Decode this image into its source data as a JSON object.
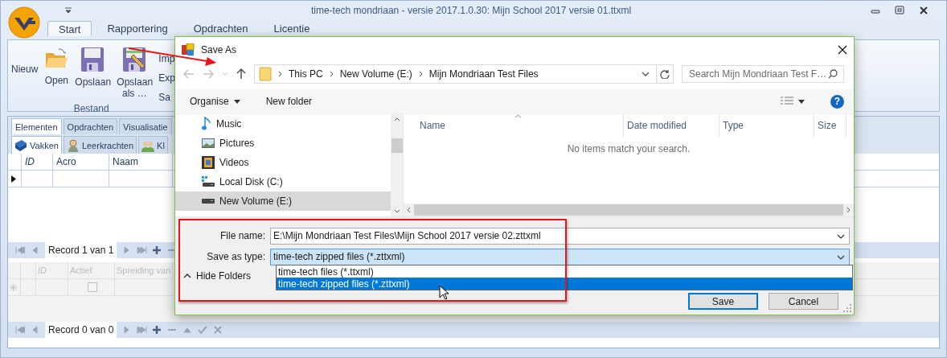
{
  "window": {
    "title": "time-tech mondriaan - versie 2017.1.0.30: Mijn School 2017 versie 01.ttxml"
  },
  "ribbon": {
    "tabs": [
      {
        "label": "Start",
        "selected": true
      },
      {
        "label": "Rapportering",
        "selected": false
      },
      {
        "label": "Opdrachten",
        "selected": false
      },
      {
        "label": "Licentie",
        "selected": false
      }
    ],
    "items": [
      {
        "label": "Nieuw",
        "kind": "text"
      },
      {
        "label": "Open",
        "kind": "open"
      },
      {
        "label": "Opslaan",
        "kind": "save"
      },
      {
        "label": "Opslaan als …",
        "kind": "saveas"
      }
    ],
    "small_items": [
      "Imp",
      "Exp",
      "Sa"
    ],
    "group": "Bestand"
  },
  "panel_tabs": [
    {
      "label": "Elementen",
      "selected": true
    },
    {
      "label": "Opdrachten",
      "selected": false
    },
    {
      "label": "Visualisatie",
      "selected": false
    }
  ],
  "sub_tabs": [
    {
      "label": "Vakken",
      "selected": true,
      "kind": "book"
    },
    {
      "label": "Leerkrachten",
      "selected": false,
      "kind": "person"
    },
    {
      "label": "Kl",
      "selected": false,
      "kind": "group"
    }
  ],
  "grid_top": {
    "columns": [
      "ID",
      "Acro",
      "Naam"
    ],
    "navigator": "Record 1 van 1"
  },
  "grid_bottom": {
    "columns": [
      "ID",
      "Actief",
      "Spreiding van"
    ],
    "checked": false,
    "navigator": "Record 0 van 0"
  },
  "dialog": {
    "title": "Save As",
    "breadcrumb": [
      "This PC",
      "New Volume (E:)",
      "Mijn Mondriaan Test Files"
    ],
    "search": {
      "placeholder": "Search Mijn Mondriaan Test F…"
    },
    "toolbar": [
      "Organise",
      "New folder"
    ],
    "help": "?",
    "folders": [
      {
        "label": "Music",
        "kind": "music",
        "selected": false
      },
      {
        "label": "Pictures",
        "kind": "pictures",
        "selected": false
      },
      {
        "label": "Videos",
        "kind": "videos",
        "selected": false
      },
      {
        "label": "Local Disk (C:)",
        "kind": "system-drive",
        "selected": false
      },
      {
        "label": "New Volume (E:)",
        "kind": "drive",
        "selected": true
      }
    ],
    "columns": [
      "Name",
      "Date modified",
      "Type",
      "Size"
    ],
    "empty_message": "No items match your search.",
    "file_name": {
      "label": "File name:",
      "value": "E:\\Mijn Mondriaan Test Files\\Mijn School 2017 versie 02.zttxml"
    },
    "save_as_type": {
      "label": "Save as type:",
      "value": "time-tech zipped files (*.zttxml)",
      "options": [
        {
          "label": "time-tech files (*.ttxml)",
          "selected": false
        },
        {
          "label": "time-tech zipped files (*.zttxml)",
          "selected": true
        }
      ]
    },
    "hide_folders": "Hide Folders",
    "buttons": [
      "Save",
      "Cancel"
    ]
  }
}
